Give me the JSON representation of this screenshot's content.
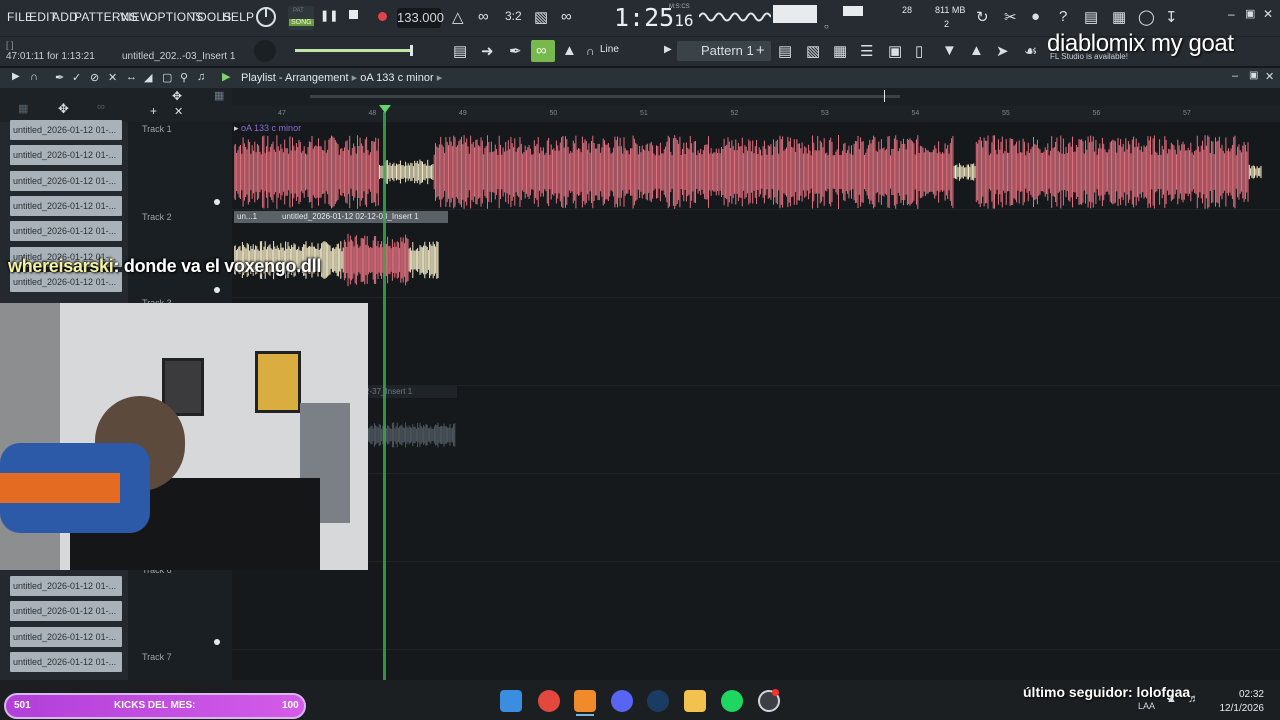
{
  "menu": {
    "file": "FILE",
    "edit": "EDIT",
    "add": "ADD",
    "patterns": "PATTERNS",
    "view": "VIEW",
    "options": "OPTIONS",
    "tools": "TOOLS",
    "help": "HELP"
  },
  "transport": {
    "pat_label": "PAT",
    "song_label": "SONG",
    "tempo": "133.000",
    "time": "1:25",
    "time_small": "16",
    "time_unit": "M:S:CS",
    "cpu_value": "28",
    "memory": "811 MB",
    "poly": "2"
  },
  "toolbar2": {
    "hint_time": "47:01:11 for 1:13:21",
    "hint_title": "untitled_202..-03_Insert 1",
    "snap": "Line",
    "pattern": "Pattern 1",
    "pattern_add": "+"
  },
  "playlist": {
    "title": "Playlist - Arrangement",
    "arrangement": "oA 133 c minor",
    "clip_header_1": "oA 133 c minor",
    "clip_header_2a": "un...1",
    "clip_header_2b": "untitled_2026-01-12 02-12-03_Insert 1",
    "ghost_clip": "2-37_Insert 1",
    "ruler": [
      "47",
      "48",
      "49",
      "50",
      "51",
      "52",
      "53",
      "54",
      "55",
      "56",
      "57"
    ],
    "tracks": [
      "Track 1",
      "Track 2",
      "Track 3",
      "Track 6",
      "Track 7"
    ]
  },
  "browser": {
    "items": [
      "untitled_2026-01-12 01-...",
      "untitled_2026-01-12 01-...",
      "untitled_2026-01-12 01-...",
      "untitled_2026-01-12 01-...",
      "untitled_2026-01-12 01-...",
      "untitled_2026-01-12 01-...",
      "untitled_2026-01-12 01-...",
      "untitled_2026-01-12 01-...",
      "untitled_2026-01-12 01-...",
      "untitled_2026-01-12 01-...",
      "untitled_2026-01-12 01-..."
    ]
  },
  "overlay": {
    "chat_user": "whereisarski",
    "chat_message": ": donde va el voxengo.dll",
    "stream_title": "diablomix my goat",
    "fl_note": "FL Studio is available!",
    "follower": "último seguidor: lolofgaa"
  },
  "goal": {
    "current": "501",
    "label": "KICKS DEL MES:",
    "target": "100"
  },
  "system": {
    "time": "02:32",
    "date": "12/1/2026",
    "lang": "LAA"
  },
  "colors": {
    "wave": "#e0707f",
    "wave_light": "#f1e7c4",
    "playhead": "#3ba64a",
    "goal": "#c24de1"
  }
}
